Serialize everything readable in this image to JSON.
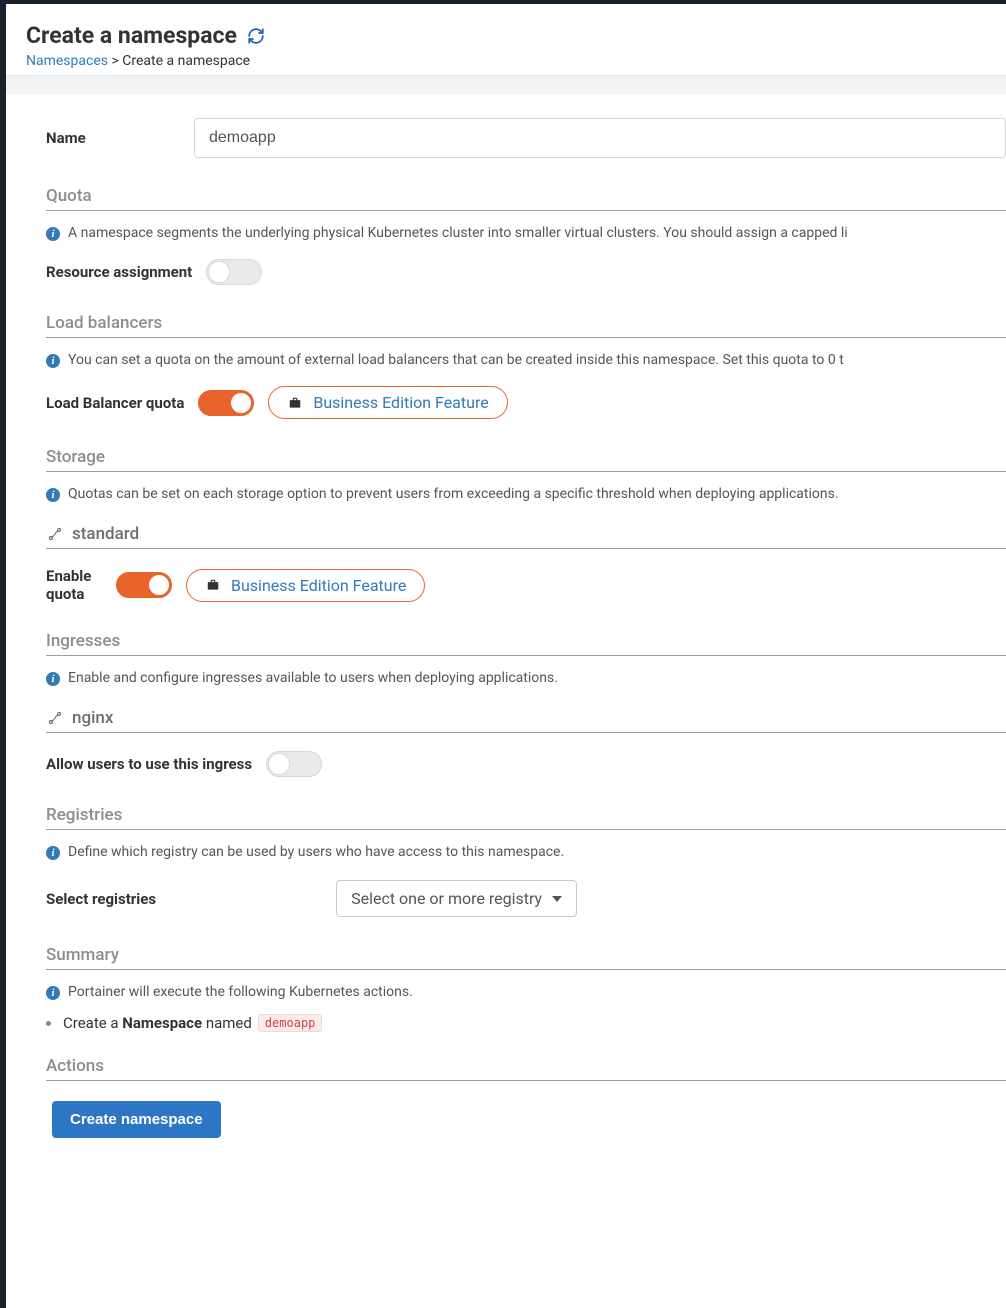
{
  "header": {
    "title": "Create a namespace",
    "breadcrumb": {
      "parent": "Namespaces",
      "current": "Create a namespace"
    }
  },
  "name": {
    "label": "Name",
    "value": "demoapp",
    "placeholder": ""
  },
  "quota": {
    "title": "Quota",
    "info": "A namespace segments the underlying physical Kubernetes cluster into smaller virtual clusters. You should assign a capped li",
    "resourceAssignment": {
      "label": "Resource assignment",
      "on": false
    }
  },
  "loadBalancers": {
    "title": "Load balancers",
    "info": "You can set a quota on the amount of external load balancers that can be created inside this namespace. Set this quota to 0 t",
    "lbQuota": {
      "label": "Load Balancer quota",
      "on": true
    },
    "beLabel": "Business Edition Feature"
  },
  "storage": {
    "title": "Storage",
    "info": "Quotas can be set on each storage option to prevent users from exceeding a specific threshold when deploying applications.",
    "option": "standard",
    "enableQuota": {
      "label": "Enable quota",
      "on": true
    },
    "beLabel": "Business Edition Feature"
  },
  "ingresses": {
    "title": "Ingresses",
    "info": "Enable and configure ingresses available to users when deploying applications.",
    "option": "nginx",
    "allow": {
      "label": "Allow users to use this ingress",
      "on": false
    }
  },
  "registries": {
    "title": "Registries",
    "info": "Define which registry can be used by users who have access to this namespace.",
    "selectLabel": "Select registries",
    "selectPlaceholder": "Select one or more registry"
  },
  "summary": {
    "title": "Summary",
    "info": "Portainer will execute the following Kubernetes actions.",
    "line": {
      "prefix": "Create a ",
      "strong": "Namespace",
      "suffix": " named ",
      "code": "demoapp"
    }
  },
  "actions": {
    "title": "Actions",
    "createBtn": "Create namespace"
  }
}
